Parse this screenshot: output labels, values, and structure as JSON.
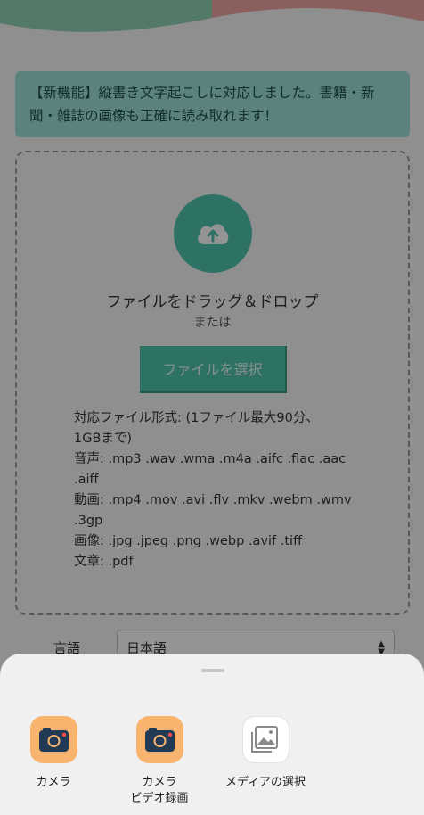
{
  "notice": {
    "line1": "【新機能】縦書き文字起こしに対応しました。書籍・新",
    "line2": "聞・雑誌の画像も正確に読み取れます！"
  },
  "dropzone": {
    "drag_text": "ファイルをドラッグ＆ドロップ",
    "or_text": "または",
    "select_button": "ファイルを選択",
    "formats": [
      "対応ファイル形式: (1ファイル最大90分、",
      "1GBまで)",
      "音声: .mp3 .wav .wma .m4a .aifc .flac .aac",
      ".aiff",
      "動画: .mp4 .mov .avi .flv .mkv .webm .wmv",
      ".3gp",
      "画像: .jpg .jpeg .png .webp .avif .tiff",
      "文章: .pdf"
    ]
  },
  "language": {
    "label": "言語",
    "selected": "日本語"
  },
  "sheet": {
    "options": [
      {
        "label": "カメラ",
        "sub": ""
      },
      {
        "label": "カメラ",
        "sub": "ビデオ録画"
      },
      {
        "label": "メディアの選択",
        "sub": ""
      }
    ]
  },
  "colors": {
    "accent": "#4fc5ad",
    "notice_bg": "#9fe0d8",
    "camera_icon_bg": "#f8b46f",
    "camera_dot": "#ff4d4d"
  },
  "icons": [
    "cloud-upload-icon",
    "camera-icon",
    "video-camera-icon",
    "gallery-icon"
  ]
}
